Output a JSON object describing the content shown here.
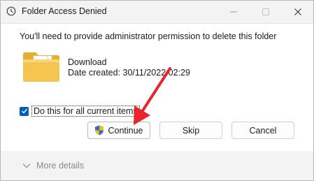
{
  "window": {
    "title": "Folder Access Denied",
    "icon": "history-clock-icon"
  },
  "message": "You'll need to provide administrator permission to delete this folder",
  "file": {
    "name": "Download",
    "date_created": "Date created: 30/11/2022 02:29",
    "icon": "folder-icon"
  },
  "checkbox": {
    "label": "Do this for all current items",
    "checked": true
  },
  "buttons": {
    "continue": "Continue",
    "skip": "Skip",
    "cancel": "Cancel"
  },
  "details_label": "More details",
  "colors": {
    "accent": "#005fb8",
    "annotation_arrow": "#e8242c",
    "folder": "#f5c451"
  }
}
